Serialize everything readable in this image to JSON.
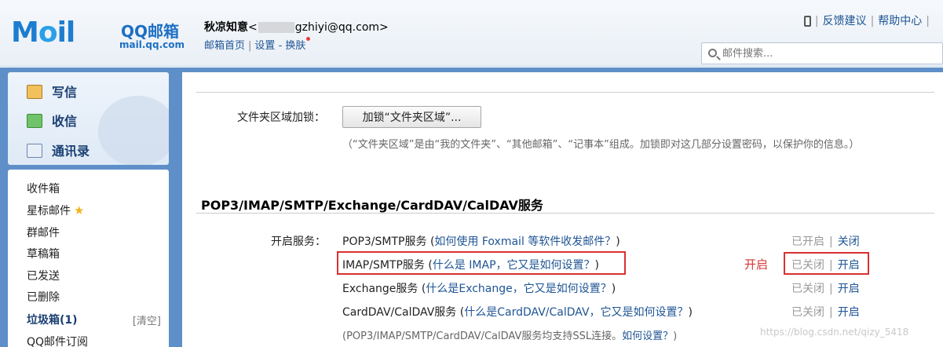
{
  "header": {
    "logo_main": "M",
    "logo_o": "o",
    "logo_rest": "il",
    "logo_brand": "QQ邮箱",
    "logo_domain": "mail.qq.com",
    "user_name": "秋凉知意",
    "user_email_prefix": "<",
    "user_email_suffix": "gzhiyi@qq.com>",
    "links": {
      "home": "邮箱首页",
      "settings": "设置",
      "dash": "-",
      "skin": "换肤"
    },
    "top_links": {
      "feedback": "反馈建议",
      "help": "帮助中心"
    },
    "search_placeholder": "邮件搜索..."
  },
  "sidebar": {
    "quick": [
      {
        "label": "写信",
        "icon": "write-icon"
      },
      {
        "label": "收信",
        "icon": "inbox-download-icon"
      },
      {
        "label": "通讯录",
        "icon": "contacts-icon"
      }
    ],
    "folders": {
      "inbox": "收件箱",
      "starred": "星标邮件",
      "group": "群邮件",
      "drafts": "草稿箱",
      "sent": "已发送",
      "deleted": "已删除",
      "junk": "垃圾箱(1)",
      "junk_clear": "[清空]",
      "subscription": "QQ邮件订阅"
    }
  },
  "main": {
    "folder_lock_label": "文件夹区域加锁：",
    "folder_lock_button": "加锁“文件夹区域”...",
    "folder_lock_desc": "（“文件夹区域”是由“我的文件夹”、“其他邮箱”、“记事本”组成。加锁即对这几部分设置密码，以保护你的信息。）",
    "section_title": "POP3/IMAP/SMTP/Exchange/CardDAV/CalDAV服务",
    "service_label": "开启服务：",
    "services": [
      {
        "name": "POP3/SMTP服务",
        "help_open": " (",
        "help": "如何使用 Foxmail 等软件收发邮件？",
        "help_close": ")",
        "status": "已开启",
        "action": "关闭"
      },
      {
        "name": "IMAP/SMTP服务",
        "help_open": " (",
        "help": "什么是 IMAP，它又是如何设置？",
        "help_close": ")",
        "status": "已关闭",
        "action": "开启"
      },
      {
        "name": "Exchange服务",
        "help_open": " (",
        "help": "什么是Exchange，它又是如何设置？",
        "help_close": ")",
        "status": "已关闭",
        "action": "开启"
      },
      {
        "name": "CardDAV/CalDAV服务",
        "help_open": " (",
        "help": "什么是CardDAV/CalDAV，它又是如何设置？",
        "help_close": ")",
        "status": "已关闭",
        "action": "开启"
      }
    ],
    "ssl_note": "(POP3/IMAP/SMTP/CardDAV/CalDAV服务均支持SSL连接。",
    "ssl_help": "如何设置？",
    "ssl_close": ")",
    "annotation": "开启",
    "watermark": "https://blog.csdn.net/qizy_5418"
  },
  "colors": {
    "link": "#1e5494",
    "nav_bg": "#5e8fc8",
    "annotation_red": "#d93030"
  }
}
